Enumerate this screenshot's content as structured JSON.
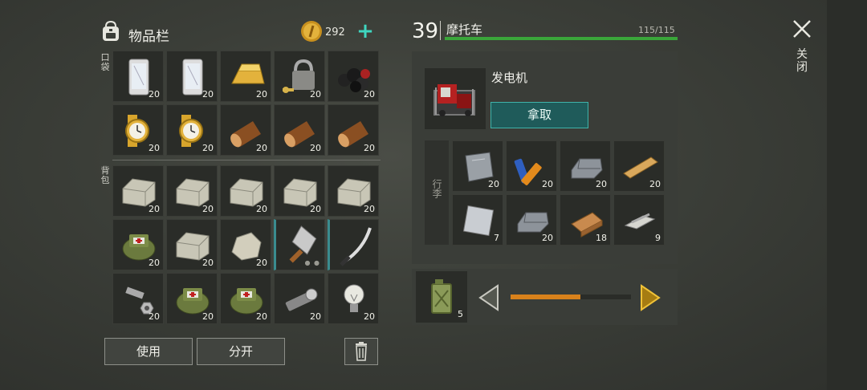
{
  "inventory": {
    "title": "物品栏",
    "coins": "292",
    "add_icon": "plus-icon",
    "pocket_label": "口袋",
    "backpack_label": "背包",
    "pocket_items": [
      {
        "name": "smartphone",
        "qty": "20"
      },
      {
        "name": "smartphone",
        "qty": "20"
      },
      {
        "name": "gold-bar",
        "qty": "20"
      },
      {
        "name": "padlock-key",
        "qty": "20"
      },
      {
        "name": "coal",
        "qty": "20"
      },
      {
        "name": "gold-watch",
        "qty": "20"
      },
      {
        "name": "gold-watch",
        "qty": "20"
      },
      {
        "name": "log",
        "qty": "20"
      },
      {
        "name": "log",
        "qty": "20"
      },
      {
        "name": "log",
        "qty": "20"
      }
    ],
    "backpack_items": [
      {
        "name": "stone-block",
        "qty": "20"
      },
      {
        "name": "stone-block",
        "qty": "20"
      },
      {
        "name": "stone-block",
        "qty": "20"
      },
      {
        "name": "stone-block",
        "qty": "20"
      },
      {
        "name": "stone-block",
        "qty": "20"
      },
      {
        "name": "medkit-bag",
        "qty": "20"
      },
      {
        "name": "stone-block",
        "qty": "20"
      },
      {
        "name": "rock",
        "qty": "20"
      },
      {
        "name": "cleaver",
        "qty": ""
      },
      {
        "name": "katana",
        "qty": ""
      },
      {
        "name": "bolt-nut",
        "qty": "20"
      },
      {
        "name": "medkit-bag",
        "qty": "20"
      },
      {
        "name": "medkit-bag",
        "qty": "20"
      },
      {
        "name": "flashlight",
        "qty": "20"
      },
      {
        "name": "light-bulb",
        "qty": "20"
      }
    ],
    "use_label": "使用",
    "split_label": "分开"
  },
  "container": {
    "level": "39",
    "name": "摩托车",
    "capacity": "115/115",
    "capacity_fraction": 1.0,
    "bar_color": "#3aa63a",
    "item_name": "发电机",
    "take_label": "拿取",
    "cargo_label": "行李",
    "cargo_items": [
      {
        "name": "metal-plate",
        "qty": "20"
      },
      {
        "name": "batteries",
        "qty": "20"
      },
      {
        "name": "iron-ingot",
        "qty": "20"
      },
      {
        "name": "wood-plank",
        "qty": "20"
      },
      {
        "name": "sheet-metal",
        "qty": "7"
      },
      {
        "name": "iron-ingot",
        "qty": "20"
      },
      {
        "name": "wood-plank-thick",
        "qty": "18"
      },
      {
        "name": "nails",
        "qty": "9"
      }
    ]
  },
  "fuel": {
    "qty": "5",
    "slider_fraction": 0.58,
    "slider_color": "#d8811b"
  },
  "close": {
    "label": "关闭"
  }
}
